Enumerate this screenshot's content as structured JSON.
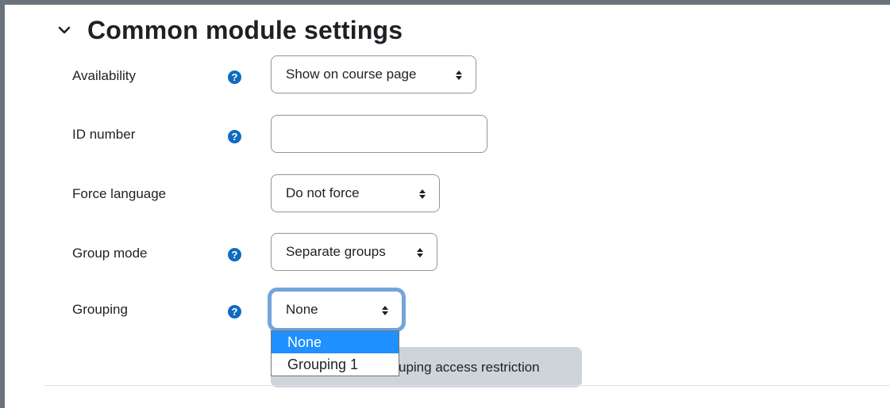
{
  "section": {
    "title": "Common module settings"
  },
  "fields": {
    "availability": {
      "label": "Availability",
      "value": "Show on course page"
    },
    "id_number": {
      "label": "ID number",
      "value": "",
      "placeholder": ""
    },
    "force_language": {
      "label": "Force language",
      "value": "Do not force"
    },
    "group_mode": {
      "label": "Group mode",
      "value": "Separate groups"
    },
    "grouping": {
      "label": "Grouping",
      "value": "None"
    }
  },
  "help_icon_glyph": "?",
  "grouping_dropdown": {
    "options": [
      {
        "label": "None",
        "selected": true
      },
      {
        "label": "Grouping 1",
        "selected": false
      }
    ]
  },
  "restriction_button": {
    "visible_label": "uping access restriction"
  },
  "colors": {
    "accent": "#0f6cbf",
    "focus_ring": "#72a6dd",
    "selected_option": "#1e90ff",
    "secondary_button": "#ced4da",
    "frame": "#6a737b"
  }
}
